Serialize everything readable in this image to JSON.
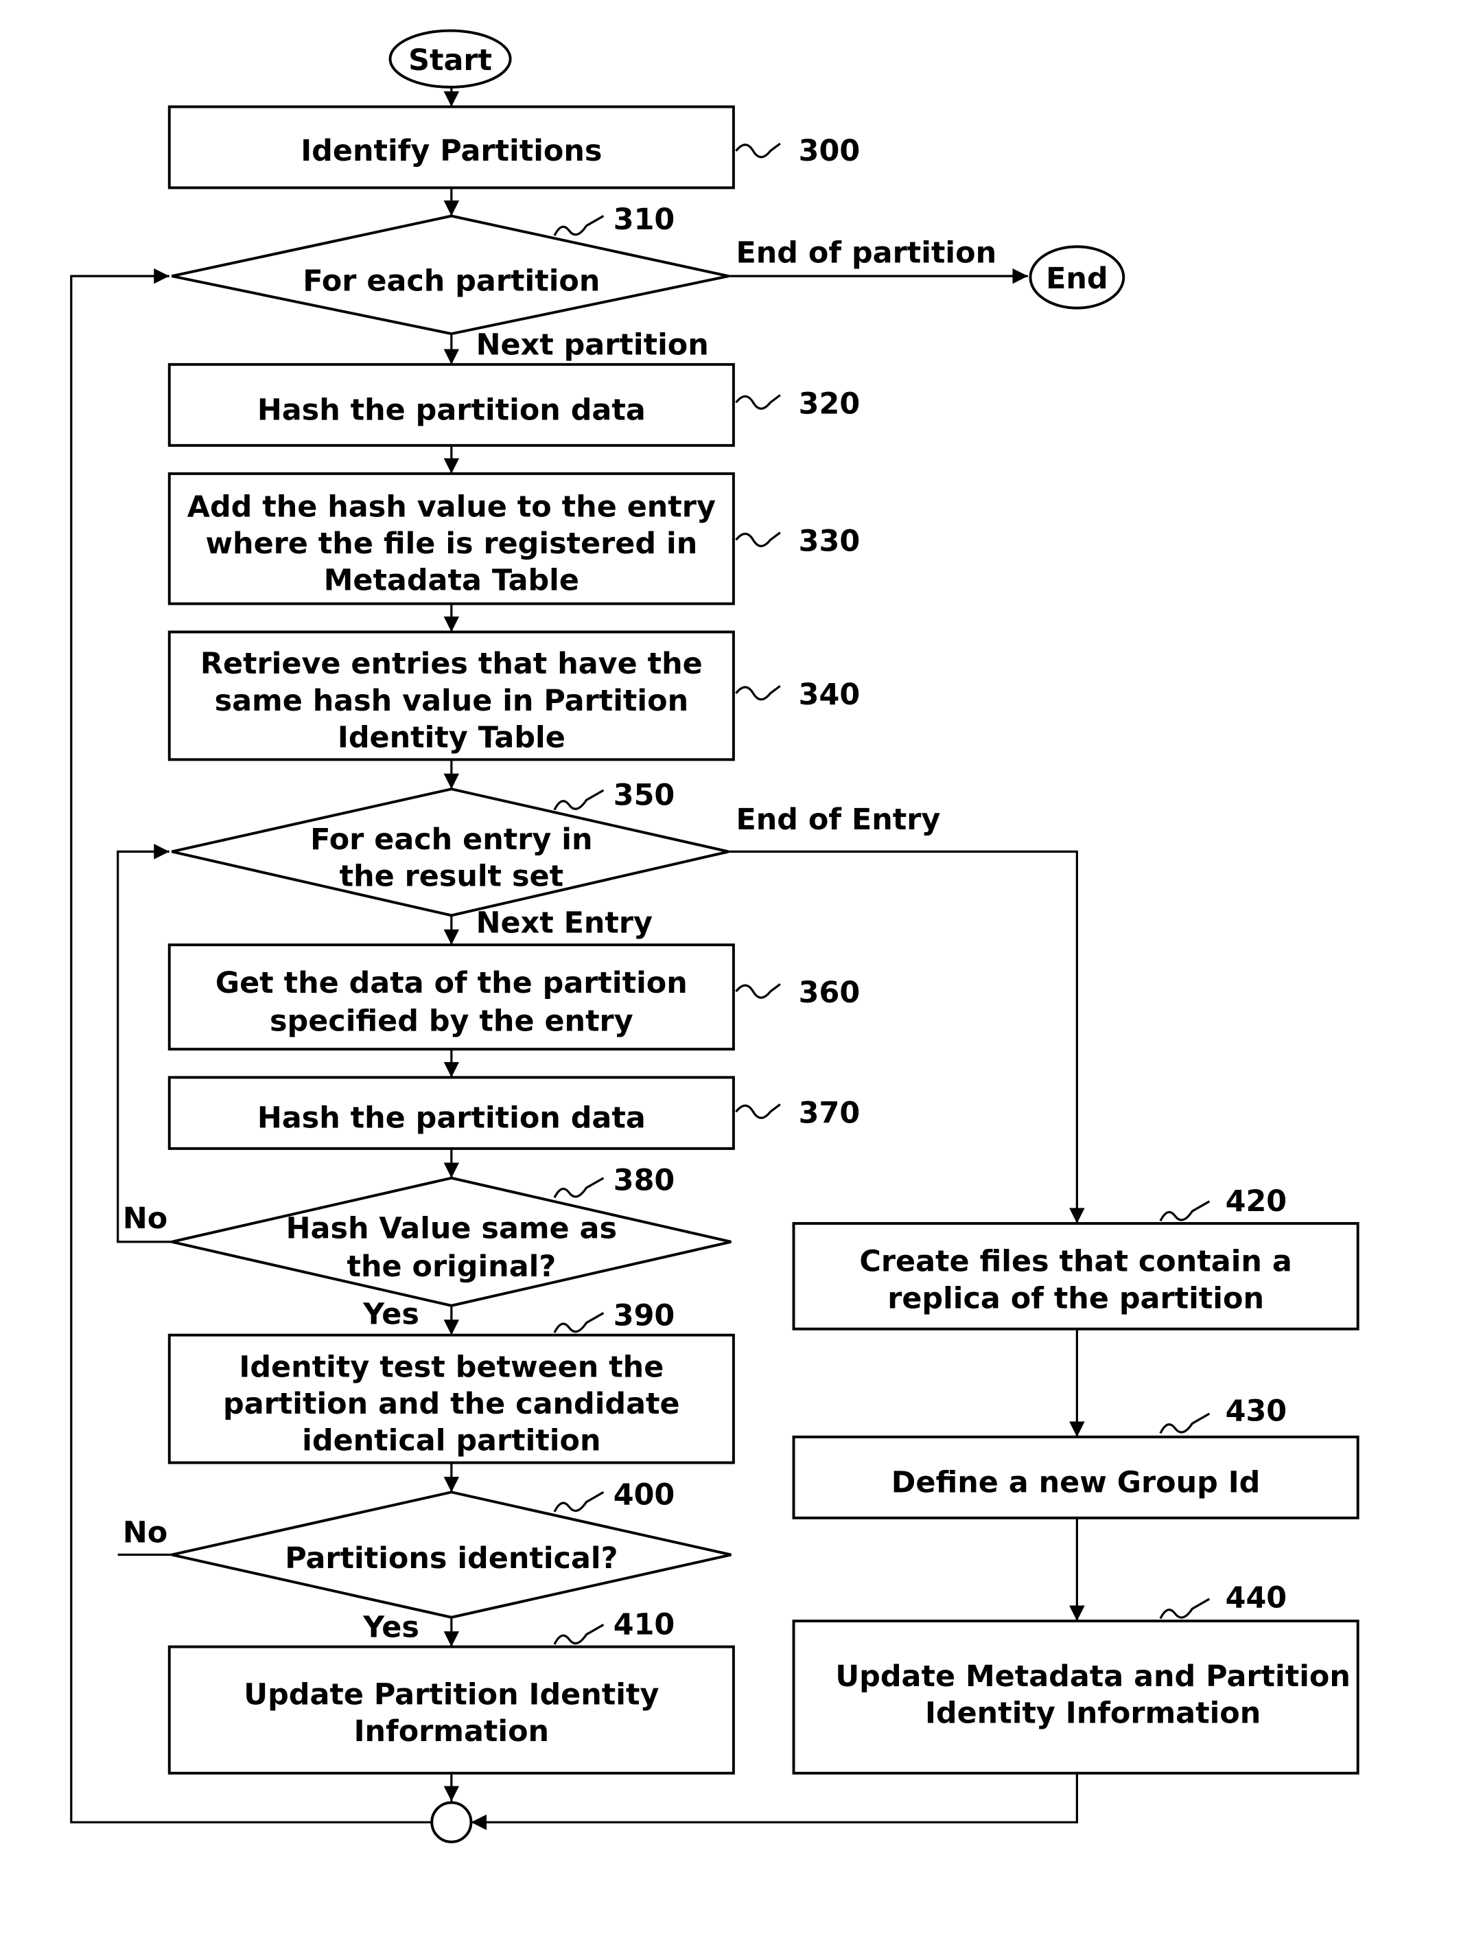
{
  "terminals": {
    "start": "Start",
    "end": "End"
  },
  "steps": {
    "s300": {
      "ref": "300",
      "lines": [
        "Identify Partitions"
      ]
    },
    "s310": {
      "ref": "310",
      "lines": [
        "For each partition"
      ]
    },
    "s320": {
      "ref": "320",
      "lines": [
        "Hash the partition data"
      ]
    },
    "s330": {
      "ref": "330",
      "lines": [
        "Add the hash value to the entry",
        "where the file is registered in",
        "Metadata Table"
      ]
    },
    "s340": {
      "ref": "340",
      "lines": [
        "Retrieve entries that have the",
        "same hash value in Partition",
        "Identity Table"
      ]
    },
    "s350": {
      "ref": "350",
      "lines": [
        "For each entry in",
        "the result set"
      ]
    },
    "s360": {
      "ref": "360",
      "lines": [
        "Get the data of the partition",
        "specified by the entry"
      ]
    },
    "s370": {
      "ref": "370",
      "lines": [
        "Hash the partition data"
      ]
    },
    "s380": {
      "ref": "380",
      "lines": [
        "Hash Value same as",
        "the original?"
      ]
    },
    "s390": {
      "ref": "390",
      "lines": [
        "Identity test between the",
        "partition and the candidate",
        "identical partition"
      ]
    },
    "s400": {
      "ref": "400",
      "lines": [
        "Partitions identical?"
      ]
    },
    "s410": {
      "ref": "410",
      "lines": [
        "Update Partition Identity",
        "Information"
      ]
    },
    "s420": {
      "ref": "420",
      "lines": [
        "Create files that contain a",
        "replica of the partition"
      ]
    },
    "s430": {
      "ref": "430",
      "lines": [
        "Define a new Group Id"
      ]
    },
    "s440": {
      "ref": "440",
      "lines": [
        "Update Metadata and Partition",
        "Identity Information"
      ]
    }
  },
  "edge_labels": {
    "end_of_partition": "End of partition",
    "next_partition": "Next partition",
    "end_of_entry": "End of Entry",
    "next_entry": "Next Entry",
    "no_380": "No",
    "yes_380": "Yes",
    "no_400": "No",
    "yes_400": "Yes"
  }
}
